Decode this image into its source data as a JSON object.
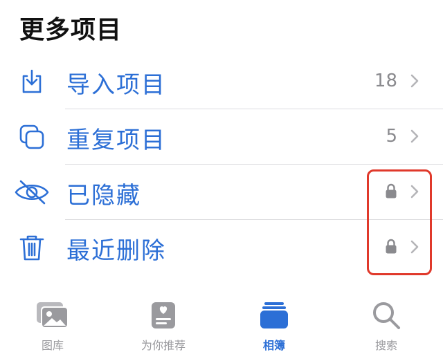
{
  "section": {
    "title": "更多项目"
  },
  "items": [
    {
      "label": "导入项目",
      "count": "18",
      "icon": "import-icon"
    },
    {
      "label": "重复项目",
      "count": "5",
      "icon": "duplicate-icon"
    },
    {
      "label": "已隐藏",
      "icon": "eye-slash-icon",
      "locked": true
    },
    {
      "label": "最近删除",
      "icon": "trash-icon",
      "locked": true
    }
  ],
  "tabs": [
    {
      "label": "图库",
      "icon": "photo-library-icon",
      "active": false
    },
    {
      "label": "为你推荐",
      "icon": "for-you-icon",
      "active": false
    },
    {
      "label": "相簿",
      "icon": "albums-icon",
      "active": true
    },
    {
      "label": "搜索",
      "icon": "search-icon",
      "active": false
    }
  ],
  "colors": {
    "accent": "#2c6fd6",
    "highlight": "#e0392b",
    "inactive": "#9a9a9e"
  }
}
